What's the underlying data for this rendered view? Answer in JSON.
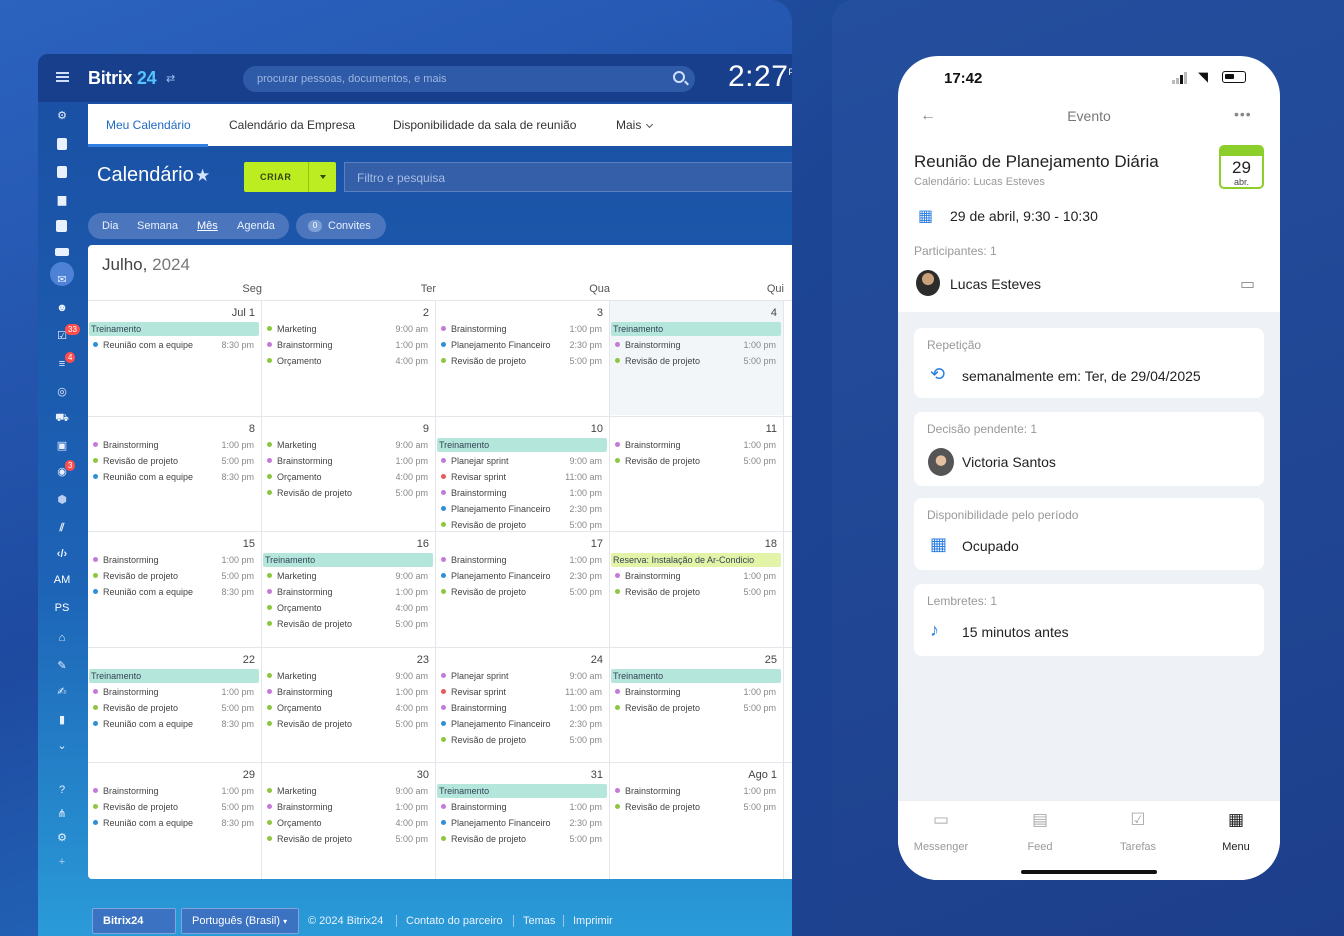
{
  "app": {
    "logo_main": "Bitrix",
    "logo_num": "24",
    "search_placeholder": "procurar pessoas, documentos, e mais",
    "clock": "2:27",
    "clock_suffix": "PM"
  },
  "tabs": [
    "Meu Calendário",
    "Calendário da Empresa",
    "Disponibilidade da sala de reunião",
    "Mais"
  ],
  "toolbar": {
    "title": "Calendário",
    "create": "CRIAR",
    "filter_placeholder": "Filtro e pesquisa"
  },
  "views": [
    "Dia",
    "Semana",
    "Mês",
    "Agenda"
  ],
  "invites": {
    "count": "0",
    "label": "Convites"
  },
  "sidebar": {
    "badge_tasks": "33",
    "badge_filter": "4",
    "badge_bot": "3",
    "am": "AM",
    "ps": "PS"
  },
  "calendar": {
    "month": "Julho,",
    "year": "2024",
    "dow": [
      "Seg",
      "Ter",
      "Qua",
      "Qui"
    ],
    "weeks": [
      [
        {
          "d": "Jul 1",
          "bar": {
            "t": "Treinamento",
            "c": "#b5e6dc"
          },
          "ev": [
            [
              "#2d8fd8",
              "Reunião com a equipe",
              "8:30 pm"
            ]
          ]
        },
        {
          "d": "2",
          "ev": [
            [
              "#8dc63f",
              "Marketing",
              "9:00 am"
            ],
            [
              "#c47ad9",
              "Brainstorming",
              "1:00 pm"
            ],
            [
              "#8dc63f",
              "Orçamento",
              "4:00 pm"
            ]
          ]
        },
        {
          "d": "3",
          "ev": [
            [
              "#c47ad9",
              "Brainstorming",
              "1:00 pm"
            ],
            [
              "#2d8fd8",
              "Planejamento Financeiro",
              "2:30 pm"
            ],
            [
              "#8dc63f",
              "Revisão de projeto",
              "5:00 pm"
            ]
          ]
        },
        {
          "d": "4",
          "today": true,
          "bar": {
            "t": "Treinamento",
            "c": "#b5e6dc"
          },
          "ev": [
            [
              "#c47ad9",
              "Brainstorming",
              "1:00 pm"
            ],
            [
              "#8dc63f",
              "Revisão de projeto",
              "5:00 pm"
            ]
          ]
        }
      ],
      [
        {
          "d": "8",
          "ev": [
            [
              "#c47ad9",
              "Brainstorming",
              "1:00 pm"
            ],
            [
              "#8dc63f",
              "Revisão de projeto",
              "5:00 pm"
            ],
            [
              "#2d8fd8",
              "Reunião com a equipe",
              "8:30 pm"
            ]
          ]
        },
        {
          "d": "9",
          "ev": [
            [
              "#8dc63f",
              "Marketing",
              "9:00 am"
            ],
            [
              "#c47ad9",
              "Brainstorming",
              "1:00 pm"
            ],
            [
              "#8dc63f",
              "Orçamento",
              "4:00 pm"
            ],
            [
              "#8dc63f",
              "Revisão de projeto",
              "5:00 pm"
            ]
          ]
        },
        {
          "d": "10",
          "bar": {
            "t": "Treinamento",
            "c": "#b5e6dc"
          },
          "ev": [
            [
              "#c47ad9",
              "Planejar sprint",
              "9:00 am"
            ],
            [
              "#e85a5a",
              "Revisar sprint",
              "11:00 am"
            ],
            [
              "#c47ad9",
              "Brainstorming",
              "1:00 pm"
            ],
            [
              "#2d8fd8",
              "Planejamento Financeiro",
              "2:30 pm"
            ],
            [
              "#8dc63f",
              "Revisão de projeto",
              "5:00 pm"
            ]
          ]
        },
        {
          "d": "11",
          "ev": [
            [
              "#c47ad9",
              "Brainstorming",
              "1:00 pm"
            ],
            [
              "#8dc63f",
              "Revisão de projeto",
              "5:00 pm"
            ]
          ]
        }
      ],
      [
        {
          "d": "15",
          "ev": [
            [
              "#c47ad9",
              "Brainstorming",
              "1:00 pm"
            ],
            [
              "#8dc63f",
              "Revisão de projeto",
              "5:00 pm"
            ],
            [
              "#2d8fd8",
              "Reunião com a equipe",
              "8:30 pm"
            ]
          ]
        },
        {
          "d": "16",
          "bar": {
            "t": "Treinamento",
            "c": "#b5e6dc"
          },
          "ev": [
            [
              "#8dc63f",
              "Marketing",
              "9:00 am"
            ],
            [
              "#c47ad9",
              "Brainstorming",
              "1:00 pm"
            ],
            [
              "#8dc63f",
              "Orçamento",
              "4:00 pm"
            ],
            [
              "#8dc63f",
              "Revisão de projeto",
              "5:00 pm"
            ]
          ]
        },
        {
          "d": "17",
          "ev": [
            [
              "#c47ad9",
              "Brainstorming",
              "1:00 pm"
            ],
            [
              "#2d8fd8",
              "Planejamento Financeiro",
              "2:30 pm"
            ],
            [
              "#8dc63f",
              "Revisão de projeto",
              "5:00 pm"
            ]
          ]
        },
        {
          "d": "18",
          "bar": {
            "t": "Reserva: Instalação de Ar-Condicio",
            "c": "#e3f4a8"
          },
          "ev": [
            [
              "#c47ad9",
              "Brainstorming",
              "1:00 pm"
            ],
            [
              "#8dc63f",
              "Revisão de projeto",
              "5:00 pm"
            ]
          ]
        }
      ],
      [
        {
          "d": "22",
          "bar": {
            "t": "Treinamento",
            "c": "#b5e6dc"
          },
          "ev": [
            [
              "#c47ad9",
              "Brainstorming",
              "1:00 pm"
            ],
            [
              "#8dc63f",
              "Revisão de projeto",
              "5:00 pm"
            ],
            [
              "#2d8fd8",
              "Reunião com a equipe",
              "8:30 pm"
            ]
          ]
        },
        {
          "d": "23",
          "ev": [
            [
              "#8dc63f",
              "Marketing",
              "9:00 am"
            ],
            [
              "#c47ad9",
              "Brainstorming",
              "1:00 pm"
            ],
            [
              "#8dc63f",
              "Orçamento",
              "4:00 pm"
            ],
            [
              "#8dc63f",
              "Revisão de projeto",
              "5:00 pm"
            ]
          ]
        },
        {
          "d": "24",
          "ev": [
            [
              "#c47ad9",
              "Planejar sprint",
              "9:00 am"
            ],
            [
              "#e85a5a",
              "Revisar sprint",
              "11:00 am"
            ],
            [
              "#c47ad9",
              "Brainstorming",
              "1:00 pm"
            ],
            [
              "#2d8fd8",
              "Planejamento Financeiro",
              "2:30 pm"
            ],
            [
              "#8dc63f",
              "Revisão de projeto",
              "5:00 pm"
            ]
          ]
        },
        {
          "d": "25",
          "bar": {
            "t": "Treinamento",
            "c": "#b5e6dc"
          },
          "ev": [
            [
              "#c47ad9",
              "Brainstorming",
              "1:00 pm"
            ],
            [
              "#8dc63f",
              "Revisão de projeto",
              "5:00 pm"
            ]
          ]
        }
      ],
      [
        {
          "d": "29",
          "ev": [
            [
              "#c47ad9",
              "Brainstorming",
              "1:00 pm"
            ],
            [
              "#8dc63f",
              "Revisão de projeto",
              "5:00 pm"
            ],
            [
              "#2d8fd8",
              "Reunião com a equipe",
              "8:30 pm"
            ]
          ]
        },
        {
          "d": "30",
          "ev": [
            [
              "#8dc63f",
              "Marketing",
              "9:00 am"
            ],
            [
              "#c47ad9",
              "Brainstorming",
              "1:00 pm"
            ],
            [
              "#8dc63f",
              "Orçamento",
              "4:00 pm"
            ],
            [
              "#8dc63f",
              "Revisão de projeto",
              "5:00 pm"
            ]
          ]
        },
        {
          "d": "31",
          "bar": {
            "t": "Treinamento",
            "c": "#b5e6dc"
          },
          "ev": [
            [
              "#c47ad9",
              "Brainstorming",
              "1:00 pm"
            ],
            [
              "#2d8fd8",
              "Planejamento Financeiro",
              "2:30 pm"
            ],
            [
              "#8dc63f",
              "Revisão de projeto",
              "5:00 pm"
            ]
          ]
        },
        {
          "d": "Ago 1",
          "ev": [
            [
              "#c47ad9",
              "Brainstorming",
              "1:00 pm"
            ],
            [
              "#8dc63f",
              "Revisão de projeto",
              "5:00 pm"
            ]
          ]
        }
      ]
    ]
  },
  "footer": {
    "logo": "Bitrix24",
    "lang": "Português (Brasil)",
    "copy": "© 2024 Bitrix24",
    "partner": "Contato do parceiro",
    "themes": "Temas",
    "print": "Imprimir"
  },
  "phone": {
    "time": "17:42",
    "header": "Evento",
    "title": "Reunião de Planejamento Diária",
    "calendar": "Calendário: Lucas Esteves",
    "badge_day": "29",
    "badge_month": "abr.",
    "datetime": "29 de abril, 9:30 - 10:30",
    "participants_label": "Participantes: 1",
    "participant": "Lucas Esteves",
    "repeat_label": "Repetição",
    "repeat_value": "semanalmente em: Ter, de 29/04/2025",
    "pending_label": "Decisão pendente: 1",
    "pending_person": "Victoria Santos",
    "avail_label": "Disponibilidade pelo período",
    "avail_value": "Ocupado",
    "remind_label": "Lembretes: 1",
    "remind_value": "15 minutos antes",
    "tabs": [
      "Messenger",
      "Feed",
      "Tarefas",
      "Menu"
    ]
  }
}
